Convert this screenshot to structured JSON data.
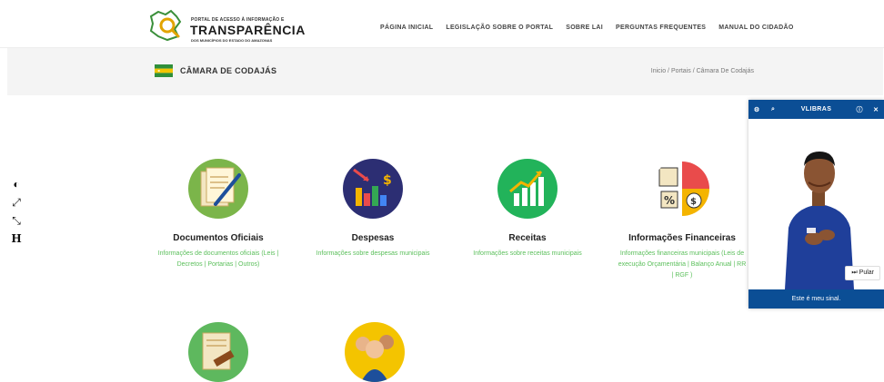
{
  "header": {
    "logo_top": "PORTAL DE ACESSO À INFORMAÇÃO E",
    "logo_main": "TRANSPARÊNCIA",
    "logo_sub": "DOS MUNICÍPIOS DO ESTADO DO AMAZONAS",
    "nav": [
      "PÁGINA INICIAL",
      "LEGISLAÇÃO SOBRE O PORTAL",
      "SOBRE LAI",
      "PERGUNTAS FREQUENTES",
      "MANUAL DO CIDADÃO"
    ]
  },
  "subheader": {
    "title": "CÂMARA DE CODAJÁS",
    "breadcrumb": [
      "Inicio",
      "Portais",
      "Câmara De Codajás"
    ]
  },
  "accessibility": [
    "contrast-icon",
    "expand-icon",
    "shrink-icon",
    "H"
  ],
  "cards": [
    {
      "title": "Documentos Oficiais",
      "desc1": "Informações de documentos oficiais (Leis |",
      "desc2": "Decretos | Portarias | Outros)",
      "desc3": ""
    },
    {
      "title": "Despesas",
      "desc1": "Informações sobre despesas municipais",
      "desc2": "",
      "desc3": ""
    },
    {
      "title": "Receitas",
      "desc1": "Informações sobre receitas municipais",
      "desc2": "",
      "desc3": ""
    },
    {
      "title": "Informações Financeiras",
      "desc1": "Informações financeiras municipais (Leis de",
      "desc2": "execução Orçamentária | Balanço Anual | RR",
      "desc3": "| RGF )"
    }
  ],
  "vlibras": {
    "brand": "VLIBRAS",
    "skip": "Pular",
    "footer": "Este é meu sinal."
  },
  "colors": {
    "accent_green": "#5bbf5b",
    "vlibras_blue": "#0b4e95"
  }
}
